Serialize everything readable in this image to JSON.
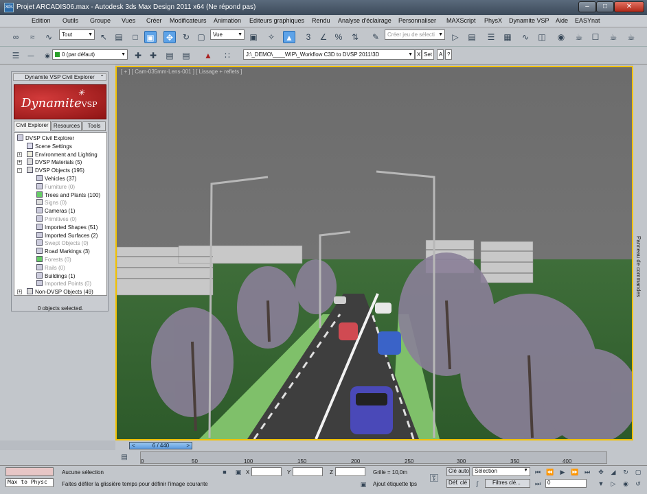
{
  "window": {
    "title": "Projet ARCADIS06.max - Autodesk 3ds Max Design 2011 x64   (Ne répond pas)"
  },
  "logo": {
    "label": "3ds"
  },
  "menu": [
    "Edition",
    "Outils",
    "Groupe",
    "Vues",
    "Créer",
    "Modificateurs",
    "Animation",
    "Editeurs graphiques",
    "Rendu",
    "Analyse d'éclairage",
    "Personnaliser",
    "MAXScript",
    "PhysX",
    "Dynamite VSP",
    "Aide",
    "EASYnat"
  ],
  "toolbar": {
    "selection_filter": "Tout",
    "ref_coord": "Vue",
    "named_selection_placeholder": "Créer jeu de sélecti",
    "layer": "0 (par défaut)",
    "project_path": "J:\\_DEMO\\____WIP\\_Workflow C3D to DVSP 2011\\3D",
    "path_x": "X",
    "path_set": "Set",
    "path_a": "A",
    "path_q": "?"
  },
  "panel": {
    "header": "Dynamite VSP Civil Explorer",
    "logo_main": "Dynamite",
    "logo_sub": "VSP",
    "tabs": [
      "Civil Explorer",
      "Resources",
      "Tools"
    ],
    "tree": [
      {
        "label": "DVSP Civil Explorer",
        "dim": false
      },
      {
        "label": "Scene Settings",
        "dim": false
      },
      {
        "label": "Environment and Lighting",
        "dim": false
      },
      {
        "label": "DVSP Materials (5)",
        "dim": false
      },
      {
        "label": "DVSP Objects (195)",
        "dim": false
      },
      {
        "label": "Vehicles (37)",
        "dim": false
      },
      {
        "label": "Furniture (0)",
        "dim": true
      },
      {
        "label": "Trees and Plants (100)",
        "dim": false
      },
      {
        "label": "Signs (0)",
        "dim": true
      },
      {
        "label": "Cameras (1)",
        "dim": false
      },
      {
        "label": "Primitives (0)",
        "dim": true
      },
      {
        "label": "Imported Shapes (51)",
        "dim": false
      },
      {
        "label": "Imported Surfaces (2)",
        "dim": false
      },
      {
        "label": "Swept Objects (0)",
        "dim": true
      },
      {
        "label": "Road Markings (3)",
        "dim": false
      },
      {
        "label": "Forests (0)",
        "dim": true
      },
      {
        "label": "Rails (0)",
        "dim": true
      },
      {
        "label": "Buildings (1)",
        "dim": false
      },
      {
        "label": "Imported Points (0)",
        "dim": true
      },
      {
        "label": "Non-DVSP Objects (49)",
        "dim": false
      }
    ],
    "status": "0 objects selected."
  },
  "viewport": {
    "label": "[ + ] [ Cam-035mm-Lens-001 ] [ Lissage + reflets ]"
  },
  "command_panel": "Panneau de commandes",
  "timeline": {
    "frame": "6 / 440",
    "ticks": [
      "0",
      "50",
      "100",
      "150",
      "200",
      "250",
      "300",
      "350",
      "400"
    ]
  },
  "status": {
    "maxscript": "Max to Physc",
    "selection": "Aucune sélection",
    "hint": "Faites défiler la glissière temps pour définir l'image courante",
    "x_label": "X",
    "y_label": "Y",
    "z_label": "Z",
    "grid": "Grille = 10,0m",
    "add_tag": "Ajout étiquette tps",
    "autokey": "Clé auto",
    "setkey": "Déf. clé",
    "key_mode": "Sélection",
    "key_filters": "Filtres clé...",
    "current_frame": "0"
  }
}
